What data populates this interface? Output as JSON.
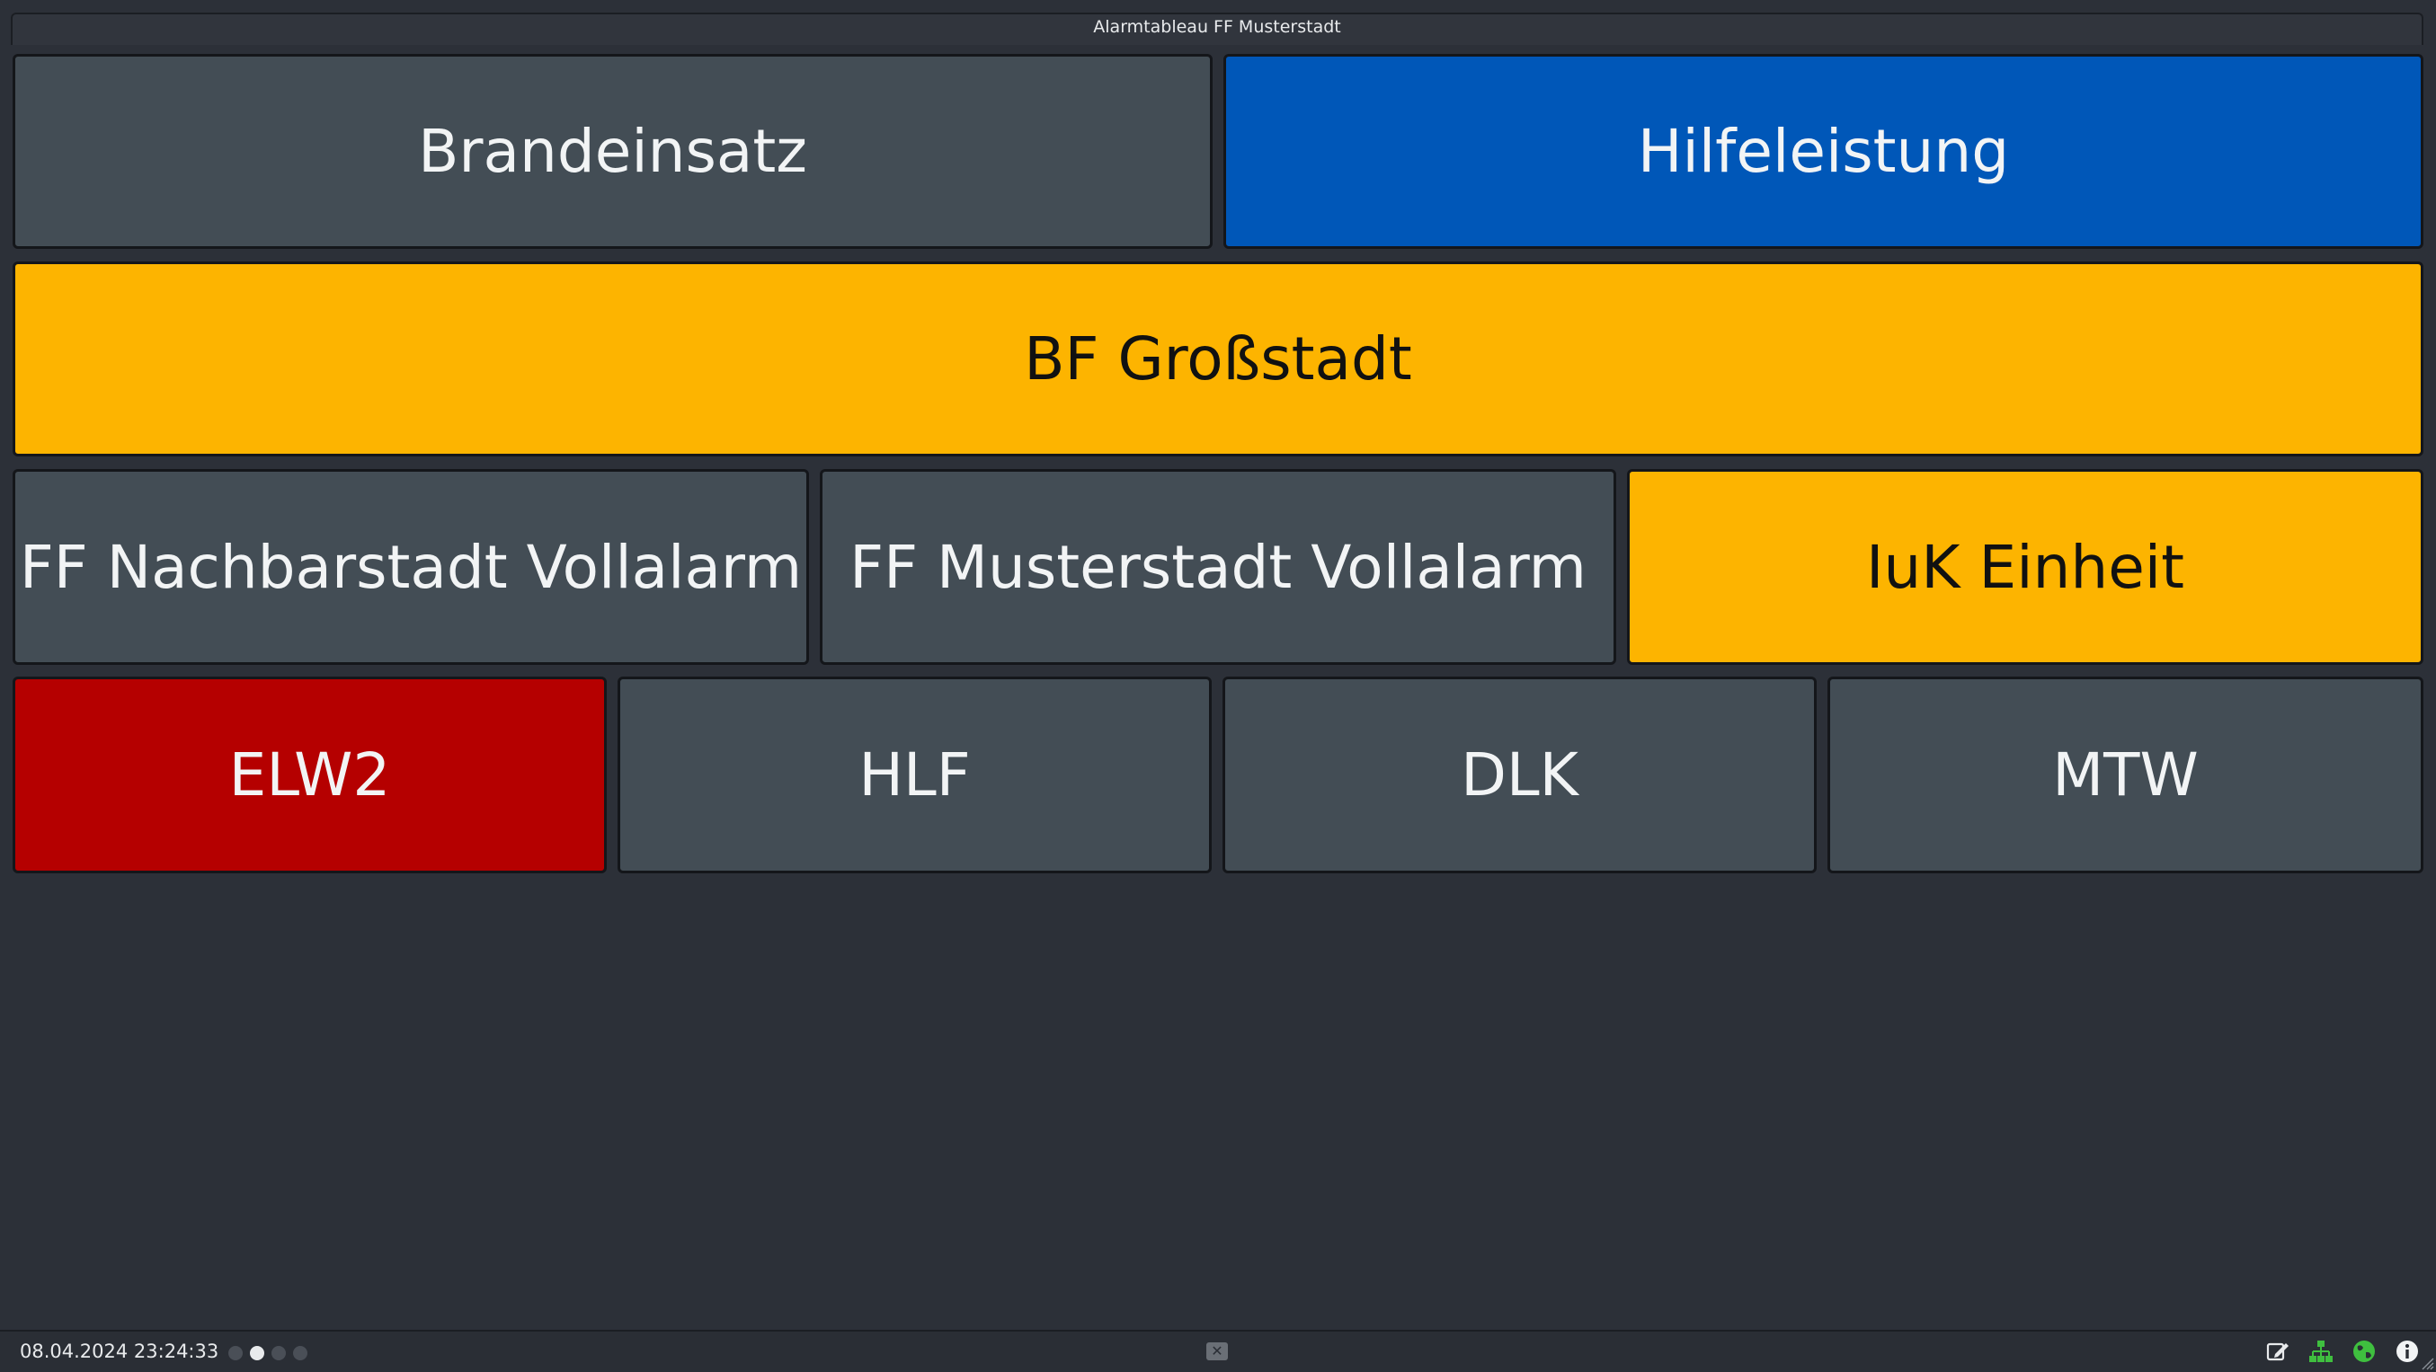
{
  "window": {
    "title": "Alarmtableau FF Musterstadt"
  },
  "colors": {
    "tile_gray": "#434d55",
    "tile_blue": "#0057b8",
    "tile_yellow": "#fdb400",
    "tile_red": "#b50000",
    "background": "#2c3038"
  },
  "tiles": {
    "brandeinsatz": "Brandeinsatz",
    "hilfeleistung": "Hilfeleistung",
    "bf_grossstadt": "BF Großstadt",
    "ff_nachbarstadt": "FF Nachbarstadt Vollalarm",
    "ff_musterstadt": "FF Musterstadt Vollalarm",
    "iuk_einheit": "IuK Einheit",
    "elw2": "ELW2",
    "hlf": "HLF",
    "dlk": "DLK",
    "mtw": "MTW"
  },
  "statusbar": {
    "datetime": "08.04.2024 23:24:33",
    "page_count": 4,
    "active_page": 2,
    "icons": [
      "edit-icon",
      "network-icon",
      "globe-icon",
      "info-icon"
    ]
  }
}
